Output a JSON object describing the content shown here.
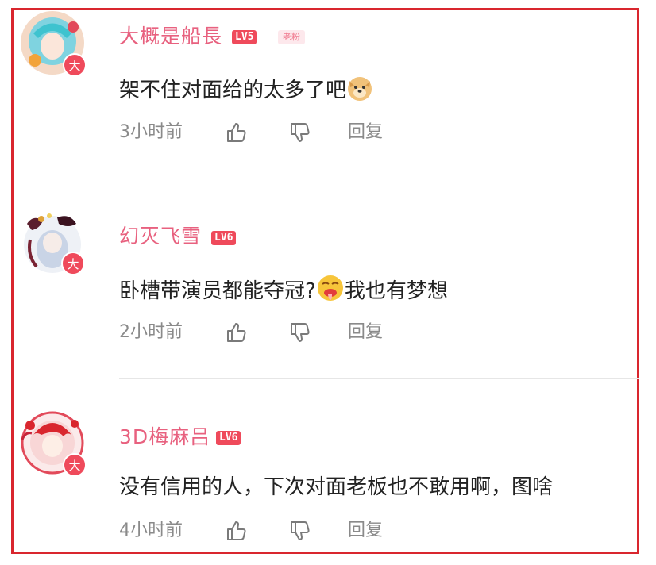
{
  "colors": {
    "frame": "#d9262e",
    "username": "#e8617f",
    "level_badge": "#ef4a5b",
    "meta_text": "#8a8a8a",
    "body_text": "#222222"
  },
  "comments": [
    {
      "username": "大概是船長",
      "level": "LV5",
      "fan_badge": "老粉",
      "text_parts": [
        "架不住对面给的太多了吧"
      ],
      "emoji": "doge-emoji",
      "time": "3小时前",
      "reply_label": "回复",
      "avatar_badge": "大"
    },
    {
      "username": "幻灭飞雪",
      "level": "LV6",
      "text_parts": [
        "卧槽带演员都能夺冠?",
        "我也有梦想"
      ],
      "emoji": "drool-emoji",
      "time": "2小时前",
      "reply_label": "回复",
      "avatar_badge": "大"
    },
    {
      "username": "3D梅麻吕",
      "level": "LV6",
      "text_parts": [
        "没有信用的人，下次对面老板也不敢用啊，图啥"
      ],
      "time": "4小时前",
      "reply_label": "回复",
      "avatar_badge": "大"
    }
  ]
}
